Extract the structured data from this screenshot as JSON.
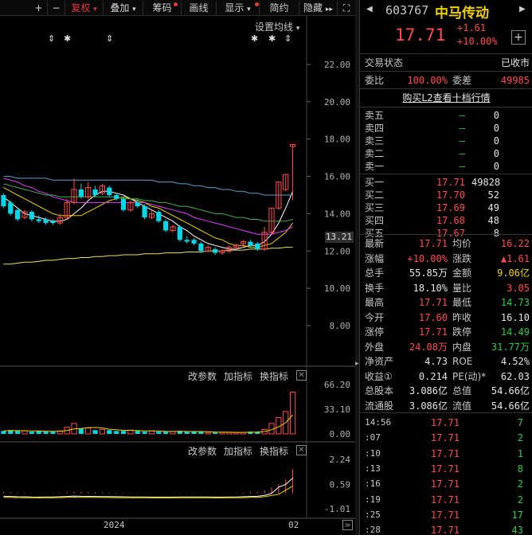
{
  "toolbar": {
    "plus": "+",
    "minus": "−",
    "fuquan": "复权",
    "diejia": "叠加",
    "chouma": "筹码",
    "huaxian": "画线",
    "xianshi": "显示",
    "jianyue": "简约",
    "yincang": "隐藏",
    "expand": "⛶",
    "accent": "#e03a3a"
  },
  "chart": {
    "ma_setting": "设置均线",
    "price_ticks": [
      "22.00",
      "20.00",
      "18.00",
      "16.00",
      "14.00",
      "12.00",
      "10.00",
      "8.00"
    ],
    "current_price_tag": "13.21",
    "vol_panel": {
      "change_params": "改参数",
      "add_indicator": "加指标",
      "swap_indicator": "换指标",
      "ticks": [
        "66.20",
        "33.10",
        "0.00"
      ]
    },
    "macd_panel": {
      "change_params": "改参数",
      "add_indicator": "加指标",
      "swap_indicator": "换指标",
      "ticks": [
        "2.24",
        "0.59",
        "-1.01"
      ]
    },
    "x_labels": [
      "2024",
      "02"
    ],
    "event_markers": [
      "⇕",
      "✱",
      "⇕",
      "✱",
      "✱",
      "⇕"
    ]
  },
  "quote": {
    "code": "603767",
    "name": "中马传动",
    "price": "17.71",
    "change": "+1.61",
    "change_pct": "+10.00%",
    "status_label": "交易状态",
    "status_value": "已收市",
    "weibi_label": "委比",
    "weibi_value": "100.00%",
    "weicha_label": "委差",
    "weicha_value": "49985",
    "l2_link": "购买L2查看十档行情"
  },
  "orderbook": {
    "asks": [
      {
        "label": "卖五",
        "price": "—",
        "vol": "0"
      },
      {
        "label": "卖四",
        "price": "—",
        "vol": "0"
      },
      {
        "label": "卖三",
        "price": "—",
        "vol": "0"
      },
      {
        "label": "卖二",
        "price": "—",
        "vol": "0"
      },
      {
        "label": "卖一",
        "price": "—",
        "vol": "0"
      }
    ],
    "bids": [
      {
        "label": "买一",
        "price": "17.71",
        "vol": "49828"
      },
      {
        "label": "买二",
        "price": "17.70",
        "vol": "52"
      },
      {
        "label": "买三",
        "price": "17.69",
        "vol": "49"
      },
      {
        "label": "买四",
        "price": "17.68",
        "vol": "48"
      },
      {
        "label": "买五",
        "price": "17.67",
        "vol": "8"
      }
    ]
  },
  "stats": [
    {
      "l1": "最新",
      "v1": "17.71",
      "c1": "red",
      "l2": "均价",
      "v2": "16.22",
      "c2": "red"
    },
    {
      "l1": "涨幅",
      "v1": "+10.00%",
      "c1": "red",
      "l2": "涨跌",
      "v2": "▲1.61",
      "c2": "red"
    },
    {
      "l1": "总手",
      "v1": "55.85万",
      "c1": "white",
      "l2": "金额",
      "v2": "9.06亿",
      "c2": "yellow"
    },
    {
      "l1": "换手",
      "v1": "18.10%",
      "c1": "white",
      "l2": "量比",
      "v2": "3.05",
      "c2": "red"
    },
    {
      "l1": "最高",
      "v1": "17.71",
      "c1": "red",
      "l2": "最低",
      "v2": "14.73",
      "c2": "green"
    },
    {
      "l1": "今开",
      "v1": "17.60",
      "c1": "red",
      "l2": "昨收",
      "v2": "16.10",
      "c2": "white"
    },
    {
      "l1": "涨停",
      "v1": "17.71",
      "c1": "red",
      "l2": "跌停",
      "v2": "14.49",
      "c2": "green"
    },
    {
      "l1": "外盘",
      "v1": "24.08万",
      "c1": "red",
      "l2": "内盘",
      "v2": "31.77万",
      "c2": "green"
    },
    {
      "l1": "净资产",
      "v1": "4.73",
      "c1": "white",
      "l2": "ROE",
      "v2": "4.52%",
      "c2": "white"
    },
    {
      "l1": "收益①",
      "v1": "0.214",
      "c1": "white",
      "l2": "PE(动)*",
      "v2": "62.03",
      "c2": "white"
    },
    {
      "l1": "总股本",
      "v1": "3.086亿",
      "c1": "white",
      "l2": "总值",
      "v2": "54.66亿",
      "c2": "white"
    },
    {
      "l1": "流通股",
      "v1": "3.086亿",
      "c1": "white",
      "l2": "流值",
      "v2": "54.66亿",
      "c2": "white"
    }
  ],
  "ticks": [
    {
      "time": "14:56",
      "price": "17.71",
      "vol": "7"
    },
    {
      "time": ":07",
      "price": "17.71",
      "vol": "2"
    },
    {
      "time": ":10",
      "price": "17.71",
      "vol": "1"
    },
    {
      "time": ":13",
      "price": "17.71",
      "vol": "8"
    },
    {
      "time": ":16",
      "price": "17.71",
      "vol": "2"
    },
    {
      "time": ":19",
      "price": "17.71",
      "vol": "2"
    },
    {
      "time": ":25",
      "price": "17.71",
      "vol": "17"
    },
    {
      "time": ":28",
      "price": "17.71",
      "vol": "43"
    }
  ],
  "colors": {
    "up": "#ff4d4d",
    "down": "#00d8e8",
    "ma5": "#ffffff",
    "ma10": "#f0d000",
    "ma20": "#e040fb",
    "ma30": "#4caf50",
    "ma60": "#5aa0d0",
    "ma120": "#f0e060"
  },
  "chart_data": {
    "type": "candlestick",
    "price_axis": [
      8.0,
      22.0
    ],
    "candles": [
      {
        "o": 15.0,
        "c": 14.4,
        "h": 15.1,
        "l": 14.3
      },
      {
        "o": 14.6,
        "c": 14.0,
        "h": 14.7,
        "l": 13.9
      },
      {
        "o": 14.2,
        "c": 13.7,
        "h": 14.3,
        "l": 13.6
      },
      {
        "o": 13.8,
        "c": 14.1,
        "h": 14.2,
        "l": 13.7
      },
      {
        "o": 14.1,
        "c": 13.7,
        "h": 14.2,
        "l": 13.6
      },
      {
        "o": 13.7,
        "c": 13.6,
        "h": 13.9,
        "l": 13.5
      },
      {
        "o": 13.7,
        "c": 13.5,
        "h": 13.8,
        "l": 13.4
      },
      {
        "o": 13.6,
        "c": 13.5,
        "h": 13.7,
        "l": 13.4
      },
      {
        "o": 13.5,
        "c": 13.8,
        "h": 14.0,
        "l": 13.4
      },
      {
        "o": 13.8,
        "c": 14.6,
        "h": 14.8,
        "l": 13.7
      },
      {
        "o": 14.6,
        "c": 15.3,
        "h": 15.9,
        "l": 14.5
      },
      {
        "o": 15.3,
        "c": 14.9,
        "h": 15.6,
        "l": 14.8
      },
      {
        "o": 14.9,
        "c": 15.4,
        "h": 15.7,
        "l": 14.8
      },
      {
        "o": 15.3,
        "c": 15.0,
        "h": 15.5,
        "l": 14.9
      },
      {
        "o": 15.1,
        "c": 15.5,
        "h": 15.6,
        "l": 15.0
      },
      {
        "o": 15.4,
        "c": 15.0,
        "h": 15.5,
        "l": 14.9
      },
      {
        "o": 15.0,
        "c": 14.8,
        "h": 15.1,
        "l": 14.7
      },
      {
        "o": 14.8,
        "c": 14.2,
        "h": 14.9,
        "l": 14.1
      },
      {
        "o": 14.2,
        "c": 14.6,
        "h": 14.7,
        "l": 14.1
      },
      {
        "o": 14.6,
        "c": 14.4,
        "h": 14.8,
        "l": 14.3
      },
      {
        "o": 14.4,
        "c": 13.8,
        "h": 14.5,
        "l": 13.7
      },
      {
        "o": 13.8,
        "c": 14.0,
        "h": 14.2,
        "l": 13.7
      },
      {
        "o": 14.1,
        "c": 13.6,
        "h": 14.2,
        "l": 13.5
      },
      {
        "o": 13.6,
        "c": 13.1,
        "h": 13.7,
        "l": 13.0
      },
      {
        "o": 13.1,
        "c": 13.3,
        "h": 13.4,
        "l": 13.0
      },
      {
        "o": 13.3,
        "c": 12.6,
        "h": 13.4,
        "l": 12.5
      },
      {
        "o": 12.6,
        "c": 12.5,
        "h": 12.8,
        "l": 12.4
      },
      {
        "o": 12.6,
        "c": 12.4,
        "h": 12.7,
        "l": 12.3
      },
      {
        "o": 12.4,
        "c": 12.0,
        "h": 12.5,
        "l": 11.9
      },
      {
        "o": 12.0,
        "c": 12.2,
        "h": 12.3,
        "l": 11.9
      },
      {
        "o": 12.1,
        "c": 11.9,
        "h": 12.2,
        "l": 11.8
      },
      {
        "o": 11.9,
        "c": 12.0,
        "h": 12.1,
        "l": 11.8
      },
      {
        "o": 12.0,
        "c": 12.2,
        "h": 12.3,
        "l": 11.9
      },
      {
        "o": 12.2,
        "c": 12.3,
        "h": 12.4,
        "l": 12.1
      },
      {
        "o": 12.4,
        "c": 12.5,
        "h": 12.6,
        "l": 12.2
      },
      {
        "o": 12.5,
        "c": 12.3,
        "h": 12.6,
        "l": 12.2
      },
      {
        "o": 12.4,
        "c": 12.1,
        "h": 12.5,
        "l": 12.0
      },
      {
        "o": 12.1,
        "c": 13.0,
        "h": 13.3,
        "l": 12.0
      },
      {
        "o": 13.0,
        "c": 14.3,
        "h": 14.3,
        "l": 12.9
      },
      {
        "o": 14.3,
        "c": 15.7,
        "h": 15.7,
        "l": 14.2
      },
      {
        "o": 15.3,
        "c": 16.1,
        "h": 16.1,
        "l": 15.2
      },
      {
        "o": 17.6,
        "c": 17.71,
        "h": 17.71,
        "l": 14.73
      }
    ],
    "ma_lines": [
      {
        "name": "ma5",
        "values": [
          14.9,
          14.6,
          14.3,
          14.0,
          13.9,
          13.8,
          13.7,
          13.6,
          13.6,
          13.7,
          14.0,
          14.3,
          14.7,
          15.0,
          15.2,
          15.2,
          15.1,
          15.0,
          14.8,
          14.6,
          14.4,
          14.2,
          14.0,
          13.8,
          13.6,
          13.3,
          13.1,
          12.8,
          12.6,
          12.4,
          12.3,
          12.2,
          12.1,
          12.1,
          12.2,
          12.3,
          12.3,
          12.5,
          12.9,
          13.5,
          14.3,
          15.2
        ]
      },
      {
        "name": "ma10",
        "values": [
          15.4,
          15.2,
          15.0,
          14.8,
          14.6,
          14.4,
          14.2,
          14.0,
          13.9,
          13.9,
          13.9,
          13.9,
          14.1,
          14.3,
          14.5,
          14.7,
          14.8,
          14.9,
          14.8,
          14.7,
          14.6,
          14.4,
          14.3,
          14.1,
          13.9,
          13.7,
          13.5,
          13.3,
          13.1,
          12.9,
          12.7,
          12.6,
          12.4,
          12.3,
          12.3,
          12.2,
          12.2,
          12.3,
          12.4,
          12.7,
          13.0,
          13.5
        ]
      },
      {
        "name": "ma20",
        "values": [
          15.9,
          15.8,
          15.7,
          15.5,
          15.4,
          15.2,
          15.1,
          14.9,
          14.8,
          14.7,
          14.6,
          14.6,
          14.6,
          14.6,
          14.6,
          14.6,
          14.6,
          14.6,
          14.6,
          14.6,
          14.6,
          14.5,
          14.4,
          14.3,
          14.2,
          14.1,
          14.0,
          13.8,
          13.7,
          13.6,
          13.5,
          13.4,
          13.3,
          13.2,
          13.1,
          13.0,
          12.9,
          12.9,
          12.9,
          13.0,
          13.1,
          13.3
        ]
      },
      {
        "name": "ma30",
        "values": [
          15.6,
          15.5,
          15.4,
          15.3,
          15.2,
          15.1,
          15.0,
          15.0,
          14.9,
          14.9,
          14.9,
          14.9,
          14.9,
          14.9,
          14.9,
          14.9,
          14.9,
          14.8,
          14.8,
          14.8,
          14.7,
          14.7,
          14.6,
          14.6,
          14.5,
          14.4,
          14.4,
          14.3,
          14.2,
          14.1,
          14.0,
          14.0,
          13.9,
          13.8,
          13.8,
          13.7,
          13.7,
          13.6,
          13.6,
          13.6,
          13.6,
          13.7
        ]
      },
      {
        "name": "ma60",
        "values": [
          16.0,
          16.0,
          15.9,
          15.9,
          15.9,
          15.9,
          15.9,
          15.8,
          15.8,
          15.8,
          15.8,
          15.8,
          15.8,
          15.8,
          15.8,
          15.8,
          15.8,
          15.8,
          15.8,
          15.8,
          15.8,
          15.8,
          15.7,
          15.7,
          15.7,
          15.6,
          15.6,
          15.5,
          15.5,
          15.4,
          15.4,
          15.3,
          15.3,
          15.2,
          15.2,
          15.1,
          15.1,
          15.0,
          15.0,
          15.0,
          15.0,
          15.0
        ]
      },
      {
        "name": "ma120",
        "values": [
          11.3,
          11.3,
          11.35,
          11.4,
          11.4,
          11.45,
          11.5,
          11.5,
          11.55,
          11.6,
          11.6,
          11.65,
          11.65,
          11.7,
          11.7,
          11.75,
          11.75,
          11.8,
          11.8,
          11.8,
          11.85,
          11.85,
          11.85,
          11.9,
          11.9,
          11.9,
          11.95,
          11.95,
          11.95,
          12.0,
          12.0,
          12.0,
          12.05,
          12.05,
          12.05,
          12.1,
          12.1,
          12.1,
          12.15,
          12.15,
          12.2,
          12.2
        ]
      }
    ],
    "volume_axis": [
      0,
      66.2
    ],
    "volumes": [
      4,
      5,
      4,
      4,
      3,
      4,
      3,
      3,
      4,
      9,
      14,
      7,
      8,
      5,
      6,
      5,
      4,
      4,
      5,
      4,
      3,
      4,
      3,
      3,
      3,
      4,
      3,
      3,
      3,
      2,
      2,
      2,
      2,
      2,
      2,
      3,
      3,
      6,
      14,
      22,
      30,
      56
    ],
    "macd_axis": [
      -1.01,
      2.24
    ],
    "macd_hist": [
      0.1,
      0.08,
      0.05,
      0.04,
      0.02,
      0.01,
      0.02,
      0.03,
      0.05,
      0.08,
      0.12,
      0.1,
      0.09,
      0.08,
      0.07,
      0.06,
      0.05,
      0.04,
      0.03,
      0.02,
      0.02,
      0.01,
      0.01,
      0.01,
      0.01,
      0.02,
      0.02,
      0.03,
      0.02,
      0.02,
      0.01,
      0.01,
      0.02,
      0.03,
      0.05,
      0.08,
      0.1,
      0.2,
      0.4,
      0.6,
      0.9,
      1.6
    ]
  }
}
